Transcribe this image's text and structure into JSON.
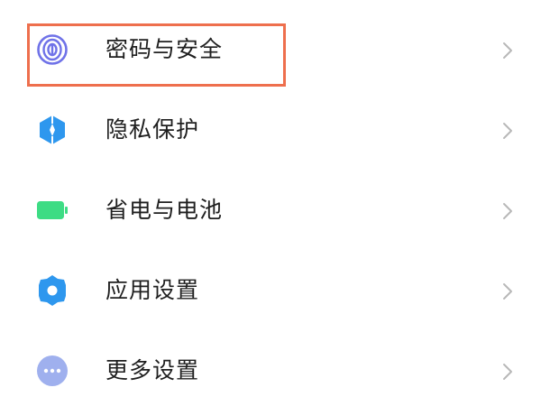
{
  "settings_list": {
    "items": [
      {
        "label": "密码与安全",
        "icon": "fingerprint-icon",
        "icon_color": "#6f72e8"
      },
      {
        "label": "隐私保护",
        "icon": "privacy-shield-icon",
        "icon_color": "#2e97ee"
      },
      {
        "label": "省电与电池",
        "icon": "battery-icon",
        "icon_color": "#3ddc84"
      },
      {
        "label": "应用设置",
        "icon": "gear-icon",
        "icon_color": "#2e97ee"
      },
      {
        "label": "更多设置",
        "icon": "more-dots-icon",
        "icon_color": "#9fb0ee"
      }
    ]
  },
  "highlight": {
    "color": "#ee6f4d",
    "target": "密码与安全"
  }
}
